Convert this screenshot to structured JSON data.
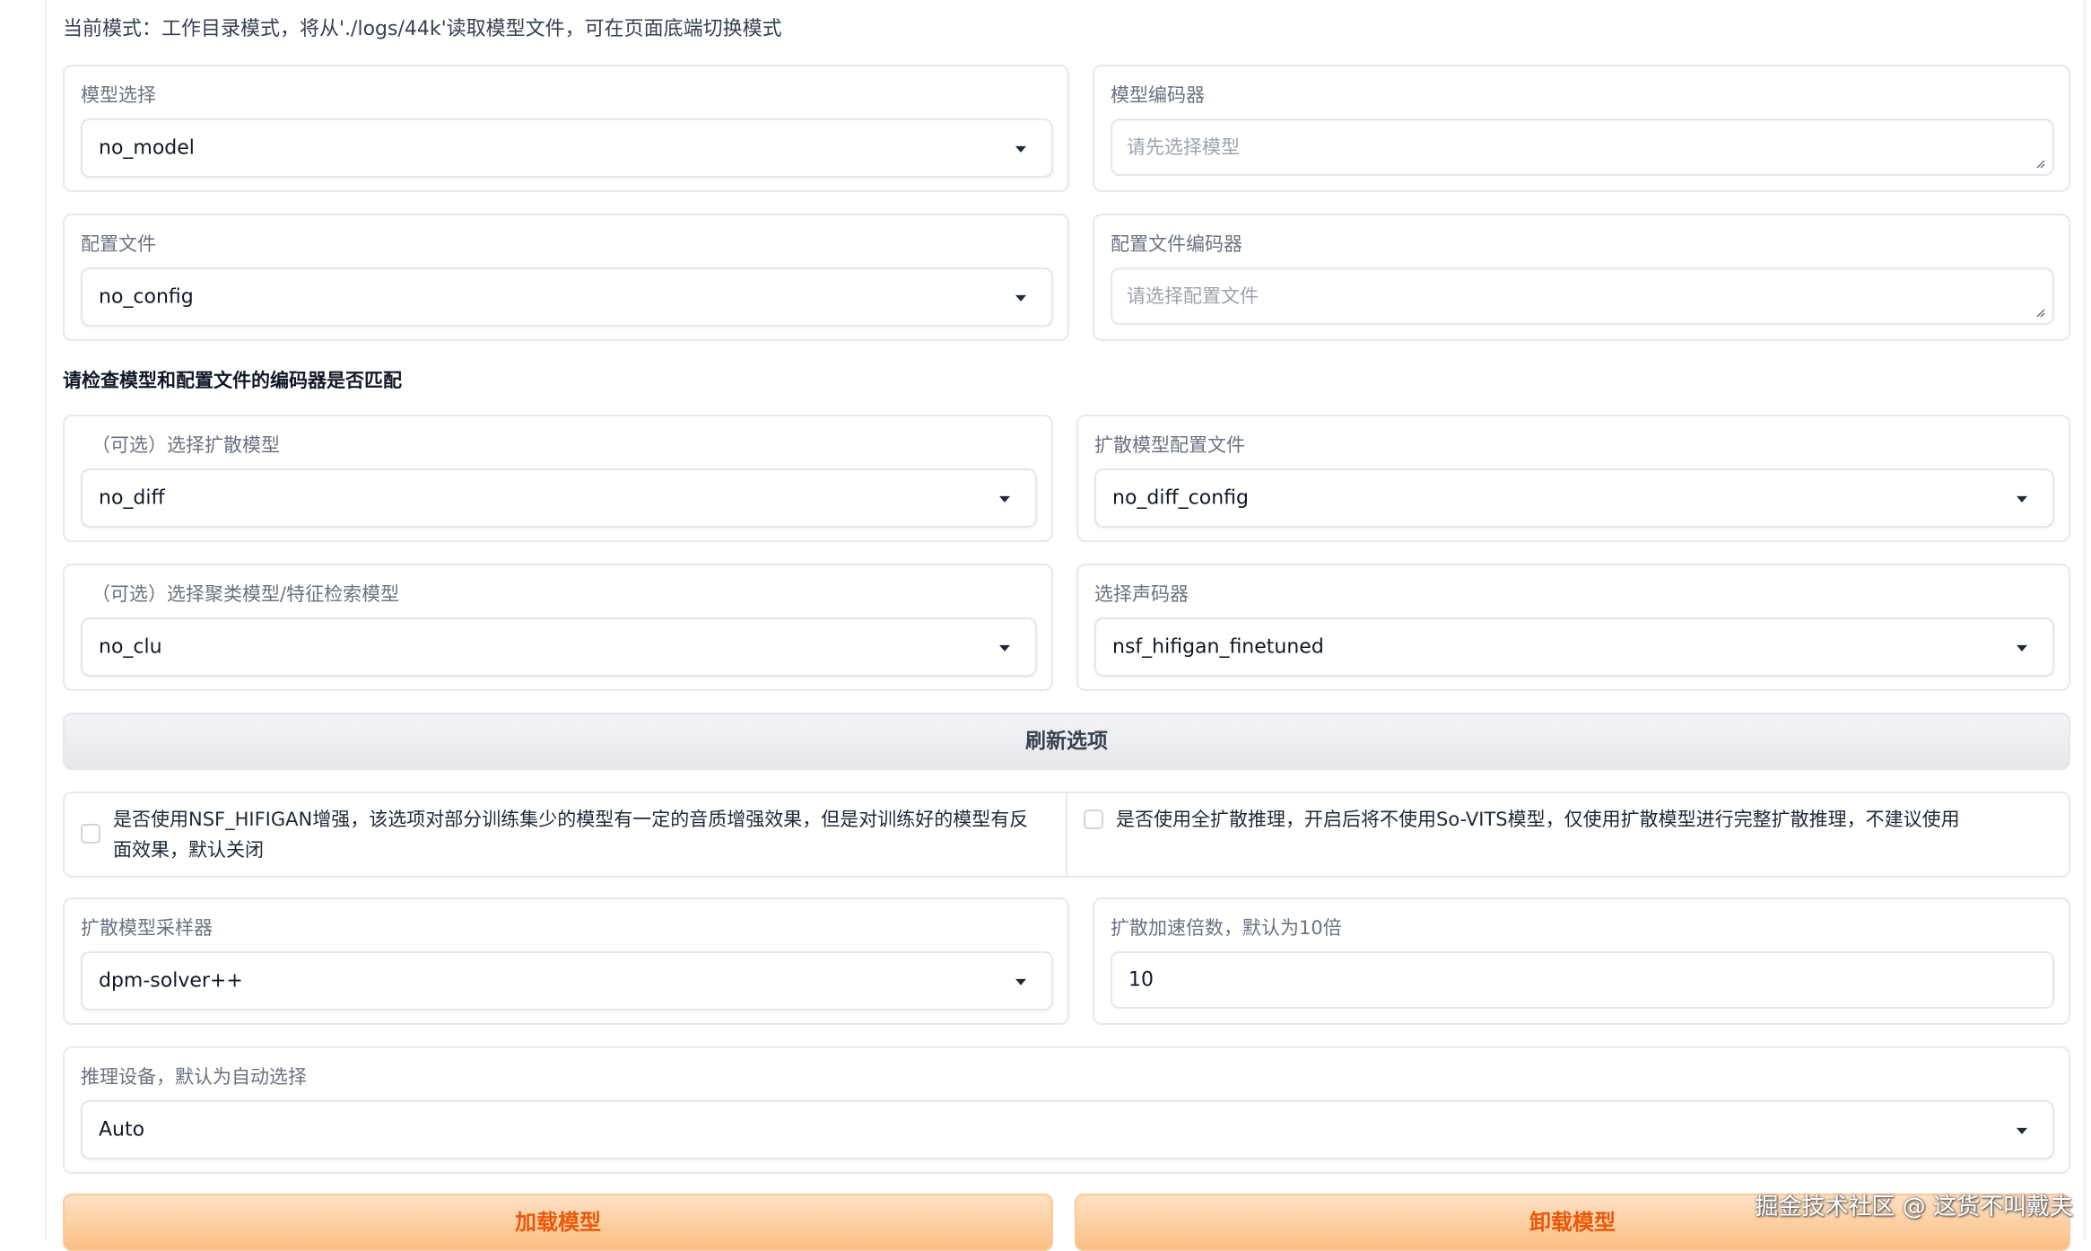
{
  "mode_text": "当前模式：工作目录模式，将从'./logs/44k'读取模型文件，可在页面底端切换模式",
  "model_select": {
    "label": "模型选择",
    "value": "no_model"
  },
  "model_encoder": {
    "label": "模型编码器",
    "placeholder": "请先选择模型"
  },
  "config_select": {
    "label": "配置文件",
    "value": "no_config"
  },
  "config_encoder": {
    "label": "配置文件编码器",
    "placeholder": "请选择配置文件"
  },
  "check_heading": "请检查模型和配置文件的编码器是否匹配",
  "diff_model": {
    "label": "（可选）选择扩散模型",
    "value": "no_diff"
  },
  "diff_config": {
    "label": "扩散模型配置文件",
    "value": "no_diff_config"
  },
  "cluster_model": {
    "label": "（可选）选择聚类模型/特征检索模型",
    "value": "no_clu"
  },
  "vocoder": {
    "label": "选择声码器",
    "value": "nsf_hifigan_finetuned"
  },
  "refresh_button": "刷新选项",
  "nsf_enhance": {
    "checked": false,
    "text": "是否使用NSF_HIFIGAN增强，该选项对部分训练集少的模型有一定的音质增强效果，但是对训练好的模型有反面效果，默认关闭"
  },
  "full_diffusion": {
    "checked": false,
    "text": "是否使用全扩散推理，开启后将不使用So-VITS模型，仅使用扩散模型进行完整扩散推理，不建议使用"
  },
  "diff_sampler": {
    "label": "扩散模型采样器",
    "value": "dpm-solver++"
  },
  "diff_speedup": {
    "label": "扩散加速倍数，默认为10倍",
    "value": "10"
  },
  "device": {
    "label": "推理设备，默认为自动选择",
    "value": "Auto"
  },
  "load_button": "加载模型",
  "unload_button": "卸载模型",
  "watermark": "掘金技术社区 @ 这货不叫戴夫",
  "colors": {
    "accent_orange": "#ea580c",
    "button_orange": "#fbbf84",
    "border": "#e7e9ed"
  }
}
